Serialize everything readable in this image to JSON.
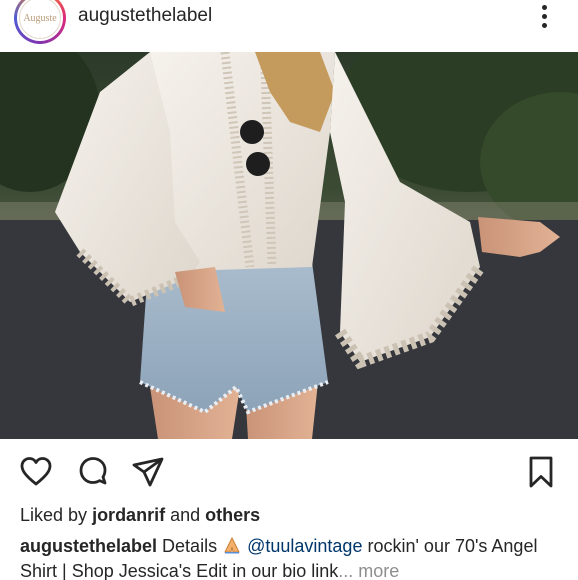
{
  "post": {
    "username": "augustethelabel",
    "avatar_text": "Auguste",
    "photo_alt": "Woman wearing white lace bell-sleeve blouse and denim shorts"
  },
  "actions": {
    "like_icon": "heart-outline",
    "comment_icon": "speech-bubble",
    "share_icon": "paper-plane",
    "save_icon": "bookmark"
  },
  "likes": {
    "prefix": "Liked by",
    "user": "jordanrif",
    "conjunction": "and",
    "others": "others"
  },
  "caption": {
    "user": "augustethelabel",
    "text_1": "Details",
    "emoji_name": "folded-hands-emoji",
    "mention": "@tuulavintage",
    "text_2": "rockin' our 70's Angel Shirt | Shop Jessica's Edit in our bio link",
    "ellipsis": "...",
    "more": "more"
  },
  "colors": {
    "text": "#262626",
    "mention": "#00376b",
    "muted": "#8e8e8e"
  }
}
